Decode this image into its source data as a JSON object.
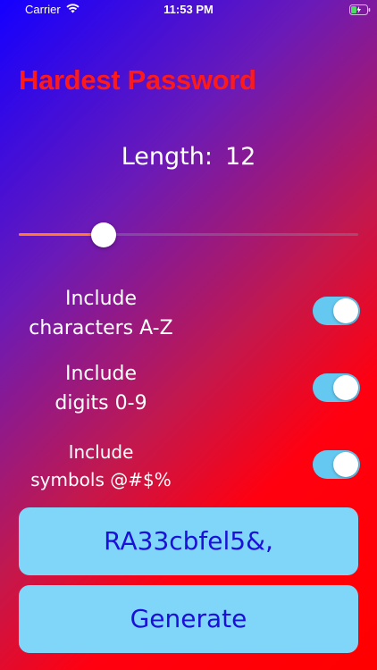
{
  "status_bar": {
    "carrier": "Carrier",
    "time": "11:53 PM",
    "wifi_icon": "wifi-icon",
    "battery_icon": "battery-charging-icon"
  },
  "app": {
    "title": "Hardest Password"
  },
  "length": {
    "label": "Length:",
    "value": "12",
    "slider_fraction": 0.25,
    "slider_fill_color": "#ff7a2e"
  },
  "options": [
    {
      "line1": "Include",
      "line2": "characters  A-Z",
      "enabled": true
    },
    {
      "line1": "Include",
      "line2": "digits  0-9",
      "enabled": true
    },
    {
      "line1": "Include",
      "line2": "symbols  @#$%",
      "enabled": true
    }
  ],
  "output": {
    "password": "RA33cbfel5&,"
  },
  "actions": {
    "generate_label": "Generate"
  },
  "colors": {
    "title": "#ff1a1a",
    "toggle_on": "#64c8f0",
    "button_bg": "#7fd6f8",
    "button_text": "#1a10d8"
  }
}
